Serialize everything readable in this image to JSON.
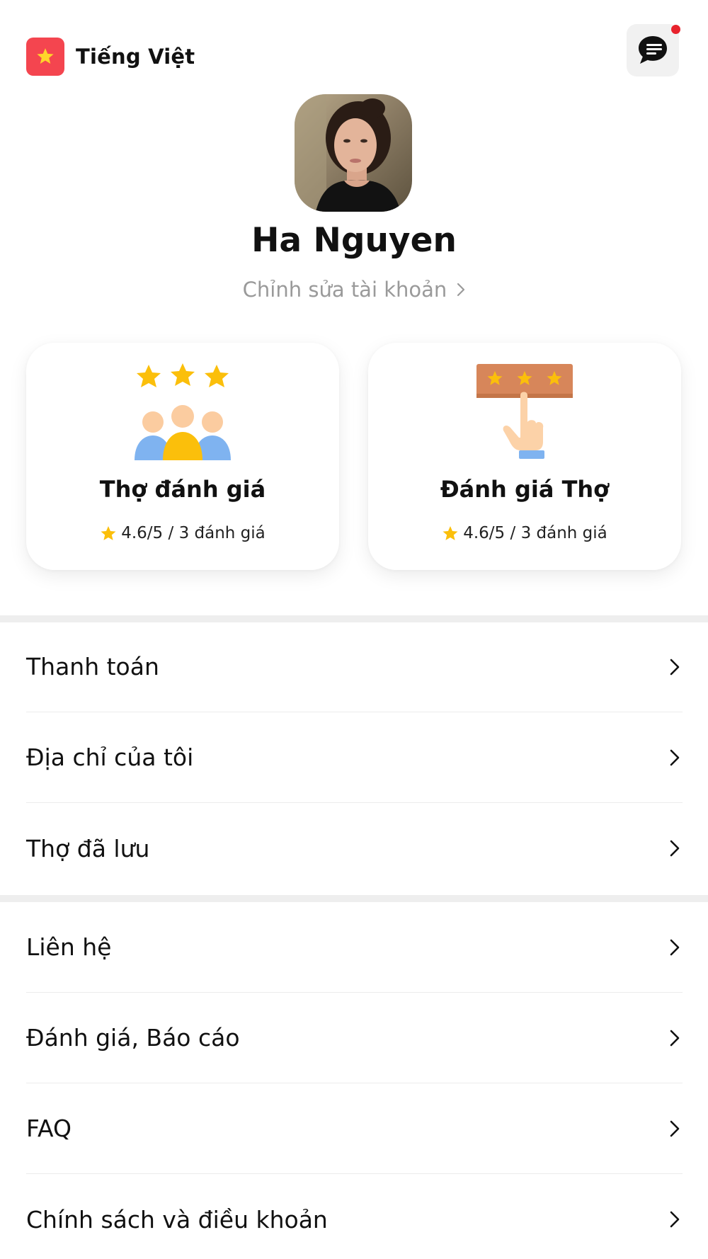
{
  "header": {
    "language_label": "Tiếng Việt",
    "language_icon": "vietnam-flag-icon",
    "chat_icon": "chat-icon",
    "has_notification": true
  },
  "profile": {
    "name": "Ha Nguyen",
    "edit_label": "Chỉnh sửa tài khoản"
  },
  "cards": [
    {
      "title": "Thợ đánh giá",
      "rating": "4.6/5 / 3 đánh giá",
      "icon": "users-rating-icon"
    },
    {
      "title": "Đánh giá Thợ",
      "rating": "4.6/5 / 3 đánh giá",
      "icon": "hand-rating-icon"
    }
  ],
  "menu": {
    "group1": [
      {
        "label": "Thanh toán"
      },
      {
        "label": "Địa chỉ của tôi"
      },
      {
        "label": "Thợ đã lưu"
      }
    ],
    "group2": [
      {
        "label": "Liên hệ"
      },
      {
        "label": "Đánh giá, Báo cáo"
      },
      {
        "label": "FAQ"
      },
      {
        "label": "Chính sách và điều khoản"
      }
    ]
  },
  "colors": {
    "accent_red": "#f4454f",
    "star_yellow": "#fbbf0b",
    "muted_text": "#9a9a9a"
  }
}
